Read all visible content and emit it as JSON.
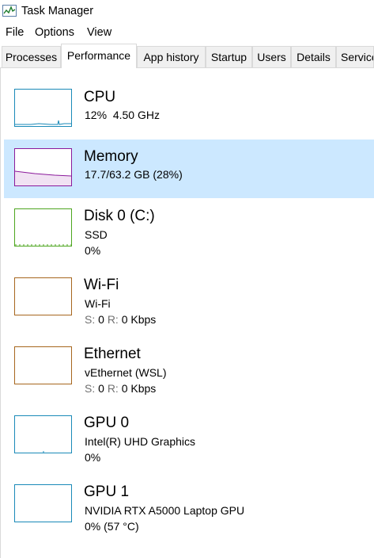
{
  "window": {
    "title": "Task Manager"
  },
  "menu": [
    "File",
    "Options",
    "View"
  ],
  "tabs": [
    "Processes",
    "Performance",
    "App history",
    "Startup",
    "Users",
    "Details",
    "Services"
  ],
  "active_tab": "Performance",
  "colors": {
    "cpu": "#1a8ab8",
    "memory": "#8b1a9b",
    "disk": "#4da61f",
    "network": "#a7661e",
    "gpu": "#1a8ab8",
    "selected_bg": "#cce8ff"
  },
  "resources": {
    "cpu": {
      "name": "CPU",
      "usage": "12%",
      "speed": "4.50 GHz"
    },
    "memory": {
      "name": "Memory",
      "usage": "17.7/63.2 GB (28%)"
    },
    "disk": {
      "name": "Disk 0 (C:)",
      "type": "SSD",
      "usage": "0%"
    },
    "wifi": {
      "name": "Wi-Fi",
      "adapter": "Wi-Fi",
      "send_label": "S:",
      "send": "0",
      "recv_label": "R:",
      "recv": "0 Kbps"
    },
    "ethernet": {
      "name": "Ethernet",
      "adapter": "vEthernet (WSL)",
      "send_label": "S:",
      "send": "0",
      "recv_label": "R:",
      "recv": "0 Kbps"
    },
    "gpu0": {
      "name": "GPU 0",
      "model": "Intel(R) UHD Graphics",
      "usage": "0%"
    },
    "gpu1": {
      "name": "GPU 1",
      "model": "NVIDIA RTX A5000 Laptop GPU",
      "usage": "0% (57 °C)"
    }
  }
}
